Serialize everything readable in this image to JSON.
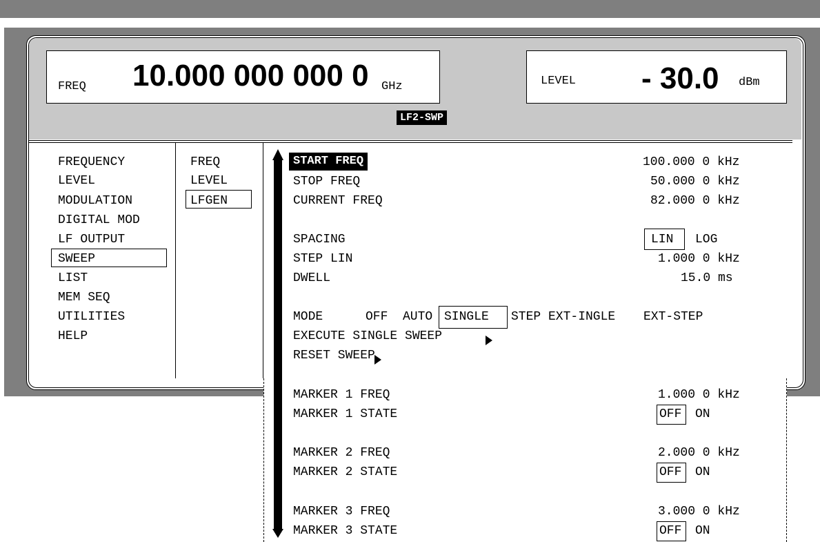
{
  "header": {
    "freq_label": "FREQ",
    "freq_value": "10.000 000 000 0",
    "freq_unit": "GHz",
    "level_label": "LEVEL",
    "level_value": "- 30.0",
    "level_unit": "dBm",
    "status_badge": "LF2-SWP"
  },
  "menu1": [
    "FREQUENCY",
    "LEVEL",
    "MODULATION",
    "DIGITAL MOD",
    "LF OUTPUT",
    "SWEEP",
    "LIST",
    "MEM SEQ",
    "UTILITIES",
    "HELP"
  ],
  "menu1_selected": "SWEEP",
  "menu2": [
    "FREQ",
    "LEVEL",
    "LFGEN"
  ],
  "menu2_selected": "LFGEN",
  "params": {
    "start_freq_label": "START FREQ",
    "start_freq_value": "100.000 0 kHz",
    "stop_freq_label": "STOP FREQ",
    "stop_freq_value": "50.000 0 kHz",
    "current_freq_label": "CURRENT FREQ",
    "current_freq_value": "82.000 0 kHz",
    "spacing_label": "SPACING",
    "spacing_options": [
      "LIN",
      "LOG"
    ],
    "spacing_selected": "LIN",
    "step_lin_label": "STEP LIN",
    "step_lin_value": "1.000 0 kHz",
    "dwell_label": "DWELL",
    "dwell_value": "15.0 ms",
    "mode_label": "MODE",
    "mode_options": [
      "OFF",
      "AUTO",
      "SINGLE",
      "STEP",
      "EXT-INGLE",
      "EXT-STEP"
    ],
    "mode_selected": "SINGLE",
    "execute_label": "EXECUTE SINGLE SWEEP",
    "reset_label": "RESET SWEEP",
    "marker1_freq_label": "MARKER 1 FREQ",
    "marker1_freq_value": "1.000 0 kHz",
    "marker1_state_label": "MARKER 1 STATE",
    "marker2_freq_label": "MARKER 2 FREQ",
    "marker2_freq_value": "2.000 0 kHz",
    "marker2_state_label": "MARKER 2 STATE",
    "marker3_freq_label": "MARKER 3 FREQ",
    "marker3_freq_value": "3.000 0 kHz",
    "marker3_state_label": "MARKER 3 STATE",
    "state_options": [
      "OFF",
      "ON"
    ],
    "state_selected": "OFF"
  }
}
